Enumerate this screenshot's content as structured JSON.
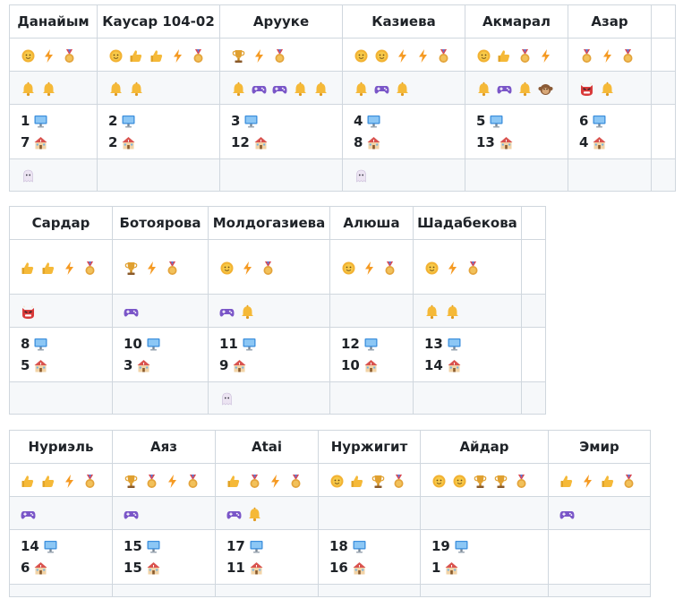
{
  "tables": [
    {
      "columns": [
        {
          "name": "Данайым",
          "achievements": [
            "sun",
            "bolt",
            "medal"
          ],
          "extras": [
            "bell",
            "bell"
          ],
          "pc": "1",
          "home": "7",
          "bottom": [
            "ghost"
          ]
        },
        {
          "name": "Каусар 104-02",
          "achievements": [
            "sun",
            "thumb",
            "thumb",
            "bolt",
            "medal"
          ],
          "extras": [
            "bell",
            "bell"
          ],
          "pc": "2",
          "home": "2",
          "bottom": []
        },
        {
          "name": "Арууке",
          "achievements": [
            "trophy",
            "bolt",
            "medal"
          ],
          "extras": [
            "bell",
            "gamepad",
            "gamepad",
            "bell",
            "bell"
          ],
          "pc": "3",
          "home": "12",
          "bottom": []
        },
        {
          "name": "Казиева",
          "achievements": [
            "sun",
            "sun",
            "bolt",
            "bolt",
            "medal"
          ],
          "extras": [
            "bell",
            "gamepad",
            "bell"
          ],
          "pc": "4",
          "home": "8",
          "bottom": [
            "ghost"
          ]
        },
        {
          "name": "Акмарал",
          "achievements": [
            "sun",
            "thumb",
            "medal",
            "bolt"
          ],
          "extras": [
            "bell",
            "gamepad",
            "bell",
            "monkey"
          ],
          "pc": "5",
          "home": "13",
          "bottom": []
        },
        {
          "name": "Азар",
          "achievements": [
            "medal",
            "bolt",
            "medal"
          ],
          "extras": [
            "ogre",
            "bell"
          ],
          "pc": "6",
          "home": "4",
          "bottom": []
        }
      ]
    },
    {
      "columns": [
        {
          "name": "Сардар",
          "achievements": [
            "thumb",
            "thumb",
            "bolt",
            "medal"
          ],
          "extras": [
            "ogre"
          ],
          "pc": "8",
          "home": "5",
          "bottom": []
        },
        {
          "name": "Ботоярова",
          "achievements": [
            "trophy",
            "bolt",
            "medal"
          ],
          "extras": [
            "gamepad"
          ],
          "pc": "10",
          "home": "3",
          "bottom": []
        },
        {
          "name": "Молдогазиева",
          "achievements": [
            "sun",
            "bolt",
            "medal"
          ],
          "extras": [
            "gamepad",
            "bell"
          ],
          "pc": "11",
          "home": "9",
          "bottom": [
            "ghost"
          ]
        },
        {
          "name": "Алюша",
          "achievements": [
            "sun",
            "bolt",
            "medal"
          ],
          "extras": [],
          "pc": "12",
          "home": "10",
          "bottom": []
        },
        {
          "name": "Шадабекова",
          "achievements": [
            "sun",
            "bolt",
            "medal"
          ],
          "extras": [
            "bell",
            "bell"
          ],
          "pc": "13",
          "home": "14",
          "bottom": []
        }
      ]
    },
    {
      "columns": [
        {
          "name": "Нуриэль",
          "achievements": [
            "thumb",
            "thumb",
            "bolt",
            "medal"
          ],
          "extras": [
            "gamepad"
          ],
          "pc": "14",
          "home": "6",
          "bottom": []
        },
        {
          "name": "Аяз",
          "achievements": [
            "trophy",
            "medal",
            "bolt",
            "medal"
          ],
          "extras": [
            "gamepad"
          ],
          "pc": "15",
          "home": "15",
          "bottom": []
        },
        {
          "name": "Atai",
          "achievements": [
            "thumb",
            "medal",
            "bolt",
            "medal"
          ],
          "extras": [
            "gamepad",
            "bell"
          ],
          "pc": "17",
          "home": "11",
          "bottom": []
        },
        {
          "name": "Нуржигит",
          "achievements": [
            "sun",
            "thumb",
            "trophy",
            "medal"
          ],
          "extras": [],
          "pc": "18",
          "home": "16",
          "bottom": []
        },
        {
          "name": "Айдар",
          "achievements": [
            "sun",
            "sun",
            "trophy",
            "trophy",
            "medal"
          ],
          "extras": [],
          "pc": "19",
          "home": "1",
          "bottom": []
        },
        {
          "name": "Эмир",
          "achievements": [
            "thumb",
            "bolt",
            "thumb",
            "medal"
          ],
          "extras": [
            "gamepad"
          ],
          "pc": "",
          "home": "",
          "bottom": []
        }
      ]
    }
  ],
  "colors": {
    "border": "#d0d7de",
    "shade": "#f6f8fa",
    "text": "#1f2328"
  }
}
